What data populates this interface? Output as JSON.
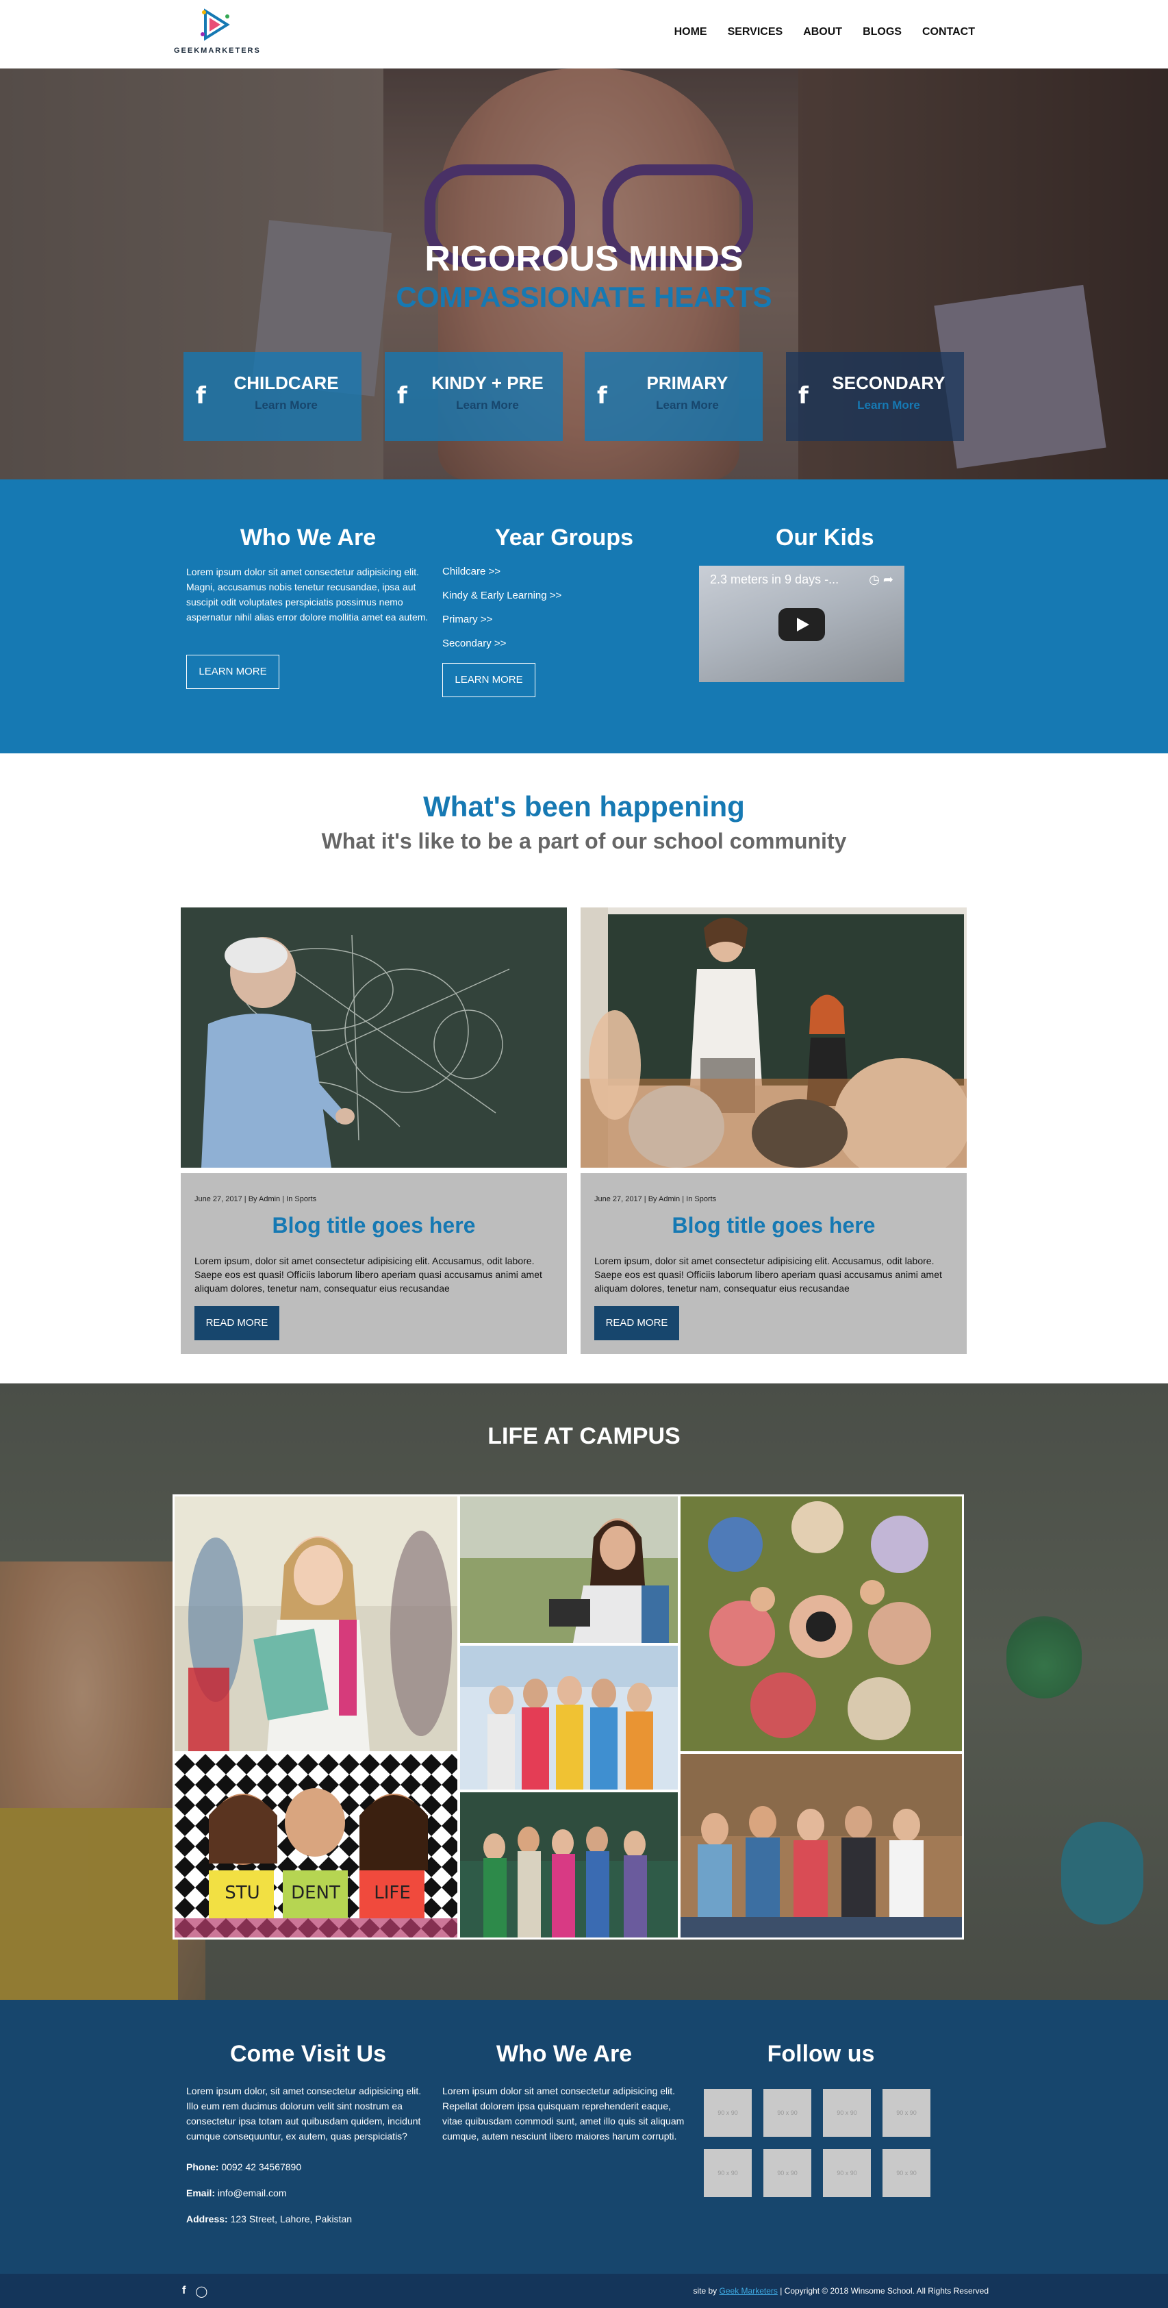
{
  "brand": {
    "logo_text": "GEEKMARKETERS"
  },
  "nav": [
    "HOME",
    "SERVICES",
    "ABOUT",
    "BLOGS",
    "CONTACT"
  ],
  "hero": {
    "title": "RIGOROUS MINDS",
    "subtitle": "COMPASSIONATE HEARTS",
    "cards": [
      {
        "icon": "facebook-icon",
        "title": "CHILDCARE",
        "link": "Learn More"
      },
      {
        "icon": "facebook-icon",
        "title": "KINDY + PRE",
        "link": "Learn More"
      },
      {
        "icon": "facebook-icon",
        "title": "PRIMARY",
        "link": "Learn More"
      },
      {
        "icon": "facebook-icon",
        "title": "SECONDARY",
        "link": "Learn More"
      }
    ]
  },
  "info": {
    "who": {
      "heading": "Who We Are",
      "text": "Lorem ipsum dolor sit amet consectetur adipisicing elit. Magni, accusamus nobis tenetur recusandae, ipsa aut suscipit odit voluptates perspiciatis possimus nemo aspernatur nihil alias error dolore mollitia amet ea autem.",
      "button": "LEARN MORE"
    },
    "years": {
      "heading": "Year Groups",
      "links": [
        "Childcare >>",
        "Kindy & Early Learning >>",
        "Primary >>",
        "Secondary >>"
      ],
      "button": "LEARN MORE"
    },
    "kids": {
      "heading": "Our Kids",
      "video_title": "2.3 meters in 9 days -..."
    }
  },
  "happening": {
    "title": "What's been happening",
    "subtitle": "What it's like to be a part of our school community",
    "posts": [
      {
        "meta": "June 27, 2017 | By Admin | In Sports",
        "title": "Blog title goes here",
        "text": "Lorem ipsum, dolor sit amet consectetur adipisicing elit. Accusamus, odit labore. Saepe eos est quasi! Officiis laborum libero aperiam quasi accusamus animi amet aliquam dolores, tenetur nam, consequatur eius recusandae",
        "button": "READ MORE"
      },
      {
        "meta": "June 27, 2017 | By Admin | In Sports",
        "title": "Blog title goes here",
        "text": "Lorem ipsum, dolor sit amet consectetur adipisicing elit. Accusamus, odit labore. Saepe eos est quasi! Officiis laborum libero aperiam quasi accusamus animi amet aliquam dolores, tenetur nam, consequatur eius recusandae",
        "button": "READ MORE"
      }
    ]
  },
  "campus": {
    "title": "LIFE AT CAMPUS",
    "signs": [
      "STU",
      "DENT",
      "LIFE"
    ]
  },
  "footer": {
    "visit": {
      "heading": "Come Visit Us",
      "text": "Lorem ipsum dolor, sit amet consectetur adipisicing elit. Illo eum rem ducimus dolorum velit sint nostrum ea consectetur ipsa totam aut quibusdam quidem, incidunt cumque consequuntur, ex autem, quas perspiciatis?",
      "phone_label": "Phone:",
      "phone": "0092 42 34567890",
      "email_label": "Email:",
      "email": "info@email.com",
      "address_label": "Address:",
      "address": "123 Street, Lahore, Pakistan"
    },
    "who": {
      "heading": "Who We Are",
      "text": "Lorem ipsum dolor sit amet consectetur adipisicing elit. Repellat dolorem ipsa quisquam reprehenderit eaque, vitae quibusdam commodi sunt, amet illo quis sit aliquam cumque, autem nesciunt libero maiores harum corrupti."
    },
    "follow": {
      "heading": "Follow us",
      "thumb_label": "90 x 90"
    },
    "social": [
      "facebook-icon",
      "instagram-icon"
    ],
    "copyright_prefix": "site by",
    "copyright_link": "Geek Marketers",
    "copyright_suffix": "| Copyright © 2018 Winsome School. All Rights Reserved"
  },
  "colors": {
    "primary": "#1679b3",
    "navy": "#17466d",
    "footer_bar": "#14355a"
  }
}
